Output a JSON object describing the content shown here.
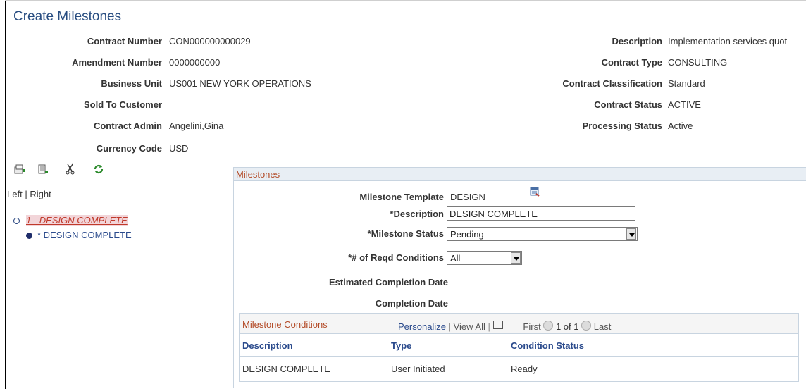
{
  "page_title": "Create Milestones",
  "header": {
    "left": [
      {
        "label": "Contract Number",
        "value": "CON000000000029"
      },
      {
        "label": "Amendment Number",
        "value": "0000000000"
      },
      {
        "label": "Business Unit",
        "value": "US001 NEW YORK OPERATIONS"
      },
      {
        "label": "Sold To Customer",
        "value": ""
      },
      {
        "label": "Contract Admin",
        "value": "Angelini,Gina"
      },
      {
        "label": "Currency Code",
        "value": "USD"
      }
    ],
    "right": [
      {
        "label": "Description",
        "value": "Implementation services quot"
      },
      {
        "label": "Contract Type",
        "value": "CONSULTING"
      },
      {
        "label": "Contract Classification",
        "value": "Standard"
      },
      {
        "label": "Contract Status",
        "value": "ACTIVE"
      },
      {
        "label": "Processing Status",
        "value": "Active"
      }
    ]
  },
  "toolbar": {
    "icons": [
      "add-milestone-icon",
      "add-condition-icon",
      "cut-icon",
      "refresh-icon"
    ]
  },
  "tree_nav": {
    "left_label": "Left",
    "separator": "|",
    "right_label": "Right",
    "items": [
      {
        "label": "1 - DESIGN COMPLETE",
        "level": 1
      },
      {
        "label": "* DESIGN COMPLETE",
        "level": 2
      }
    ]
  },
  "milestones": {
    "section_title": "Milestones",
    "template_label": "Milestone Template",
    "template_value": "DESIGN",
    "description_label": "*Description",
    "description_value": "DESIGN COMPLETE",
    "status_label": "*Milestone Status",
    "status_value": "Pending",
    "reqd_label": "*# of Reqd Conditions",
    "reqd_value": "All",
    "est_date_label": "Estimated Completion Date",
    "comp_date_label": "Completion Date"
  },
  "conditions": {
    "title": "Milestone Conditions",
    "personalize": "Personalize",
    "view_all": "View All",
    "first": "First",
    "range": "1 of 1",
    "last": "Last",
    "columns": [
      "Description",
      "Type",
      "Condition Status"
    ],
    "rows": [
      [
        "DESIGN COMPLETE",
        "User Initiated",
        "Ready"
      ]
    ]
  },
  "colors": {
    "title": "#274c80",
    "section_title": "#b34a26",
    "link": "#2a4a8c"
  }
}
